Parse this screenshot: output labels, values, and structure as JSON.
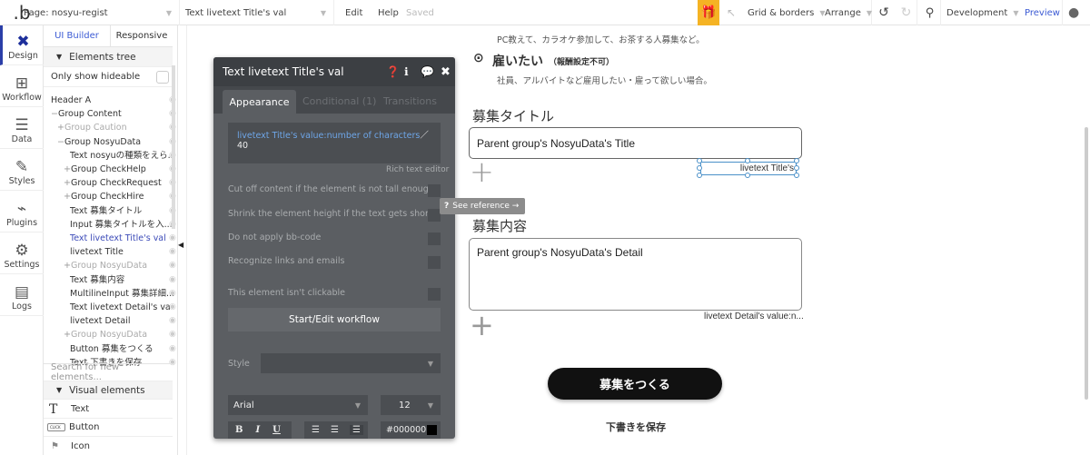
{
  "topbar": {
    "logo": ".b",
    "page": "Page: nosyu-regist",
    "element": "Text livetext Title's val",
    "edit": "Edit",
    "help": "Help",
    "saved": "Saved",
    "grid": "Grid & borders",
    "arrange": "Arrange",
    "environment": "Development",
    "preview": "Preview"
  },
  "rail": [
    {
      "label": "Design",
      "icon": "design-icon"
    },
    {
      "label": "Workflow",
      "icon": "workflow-icon"
    },
    {
      "label": "Data",
      "icon": "database-icon"
    },
    {
      "label": "Styles",
      "icon": "brush-icon"
    },
    {
      "label": "Plugins",
      "icon": "plug-icon"
    },
    {
      "label": "Settings",
      "icon": "gear-icon"
    },
    {
      "label": "Logs",
      "icon": "document-icon"
    }
  ],
  "panel": {
    "tabs": [
      "UI Builder",
      "Responsive"
    ],
    "tree_header": "Elements tree",
    "only_hideable": "Only show hideable",
    "tree": [
      {
        "label": "Header A",
        "prefix": "",
        "indent": 0,
        "style": "normal"
      },
      {
        "label": "Group Content",
        "prefix": "−",
        "indent": 0,
        "style": "normal"
      },
      {
        "label": "Group Caution",
        "prefix": "+",
        "indent": 1,
        "style": "hidden"
      },
      {
        "label": "Group NosyuData",
        "prefix": "−",
        "indent": 1,
        "style": "normal"
      },
      {
        "label": "Text nosyuの種類をえら...",
        "prefix": "",
        "indent": 2,
        "style": "normal"
      },
      {
        "label": "Group CheckHelp",
        "prefix": "+",
        "indent": 2,
        "style": "normal"
      },
      {
        "label": "Group CheckRequest",
        "prefix": "+",
        "indent": 2,
        "style": "normal"
      },
      {
        "label": "Group CheckHire",
        "prefix": "+",
        "indent": 2,
        "style": "normal"
      },
      {
        "label": "Text 募集タイトル",
        "prefix": "",
        "indent": 2,
        "style": "normal"
      },
      {
        "label": "Input 募集タイトルを入...",
        "prefix": "",
        "indent": 2,
        "style": "normal"
      },
      {
        "label": "Text livetext Title's val",
        "prefix": "",
        "indent": 2,
        "style": "selected"
      },
      {
        "label": "livetext Title",
        "prefix": "",
        "indent": 2,
        "style": "normal"
      },
      {
        "label": "Group NosyuData",
        "prefix": "+",
        "indent": 2,
        "style": "hidden"
      },
      {
        "label": "Text 募集内容",
        "prefix": "",
        "indent": 2,
        "style": "normal"
      },
      {
        "label": "MultilineInput 募集詳細...",
        "prefix": "",
        "indent": 2,
        "style": "normal"
      },
      {
        "label": "Text livetext Detail's va",
        "prefix": "",
        "indent": 2,
        "style": "normal"
      },
      {
        "label": "livetext Detail",
        "prefix": "",
        "indent": 2,
        "style": "normal"
      },
      {
        "label": "Group NosyuData",
        "prefix": "+",
        "indent": 2,
        "style": "hidden"
      },
      {
        "label": "Button 募集をつくる",
        "prefix": "",
        "indent": 2,
        "style": "normal"
      },
      {
        "label": "Text 下書きを保存",
        "prefix": "",
        "indent": 2,
        "style": "normal"
      }
    ],
    "search_placeholder": "Search for new elements...",
    "visual_header": "Visual elements",
    "visual": [
      {
        "label": "Text",
        "icon": "text-icon"
      },
      {
        "label": "Button",
        "icon": "button-icon",
        "badge": "CLICK"
      },
      {
        "label": "Icon",
        "icon": "flag-icon"
      }
    ]
  },
  "editor": {
    "title": "Text livetext Title's val",
    "tabs": [
      "Appearance",
      "Conditional (1)",
      "Transitions"
    ],
    "expression": "livetext Title's value:number of characters",
    "expression_suffix": "／40",
    "rich_text": "Rich text editor",
    "options": [
      "Cut off content if the element is not tall enough",
      "Shrink the element height if the text gets shorter",
      "Do not apply bb-code",
      "Recognize links and emails"
    ],
    "not_clickable": "This element isn't clickable",
    "workflow_button": "Start/Edit workflow",
    "style_label": "Style",
    "style_value": "",
    "font": "Arial",
    "size": "12",
    "bold": "B",
    "italic": "I",
    "underline": "U",
    "color": "#000000"
  },
  "tooltip": {
    "label": "See reference →"
  },
  "canvas": {
    "line1": "PC教えて、カラオケ参加して、お茶する人募集など。",
    "hire_title": "雇いたい",
    "hire_note": "（報酬設定不可）",
    "hire_desc": "社員、アルバイトなど雇用したい・雇って欲しい場合。",
    "title_label": "募集タイトル",
    "title_input": "Parent group's NosyuData's Title",
    "title_counter": "livetext Title's",
    "detail_label": "募集内容",
    "detail_input": "Parent group's NosyuData's Detail",
    "detail_counter": "livetext Detail's value:n...",
    "create_button": "募集をつくる",
    "save_draft": "下書きを保存"
  }
}
